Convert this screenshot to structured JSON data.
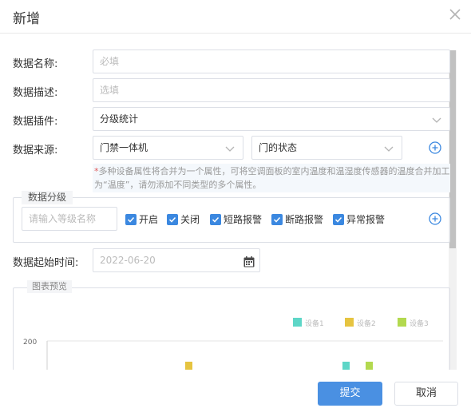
{
  "dialog": {
    "title": "新增",
    "close_icon": "close-icon"
  },
  "form": {
    "name_label": "数据名称:",
    "name_placeholder": "必填",
    "desc_label": "数据描述:",
    "desc_placeholder": "选填",
    "plugin_label": "数据插件:",
    "plugin_value": "分级统计",
    "source_label": "数据来源:",
    "source_device": "门禁一体机",
    "source_attr": "门的状态",
    "hint_star": "*",
    "hint_text": "多种设备属性将合并为一个属性，可将空调面板的室内温度和温湿度传感器的温度合并加工为“温度”，请勿添加不同类型的多个属性。"
  },
  "grading": {
    "legend": "数据分级",
    "input_placeholder": "请输入等级名称",
    "checkboxes": [
      {
        "label": "开启",
        "checked": true
      },
      {
        "label": "关闭",
        "checked": true
      },
      {
        "label": "短路报警",
        "checked": true
      },
      {
        "label": "断路报警",
        "checked": true
      },
      {
        "label": "异常报警",
        "checked": true
      }
    ]
  },
  "start_time": {
    "label": "数据起始时间:",
    "value": "2022-06-20"
  },
  "chart_preview": {
    "legend": "图表预览"
  },
  "chart_data": {
    "type": "bar",
    "title": "",
    "series": [
      {
        "name": "设备1",
        "color": "#5ed6c7"
      },
      {
        "name": "设备2",
        "color": "#e6c440"
      },
      {
        "name": "设备3",
        "color": "#b3d94f"
      }
    ],
    "y_ticks": [
      "200"
    ]
  },
  "footer": {
    "submit_label": "提交",
    "cancel_label": "取消"
  },
  "colors": {
    "primary": "#4a90e2",
    "checkbox": "#3b88e0"
  }
}
